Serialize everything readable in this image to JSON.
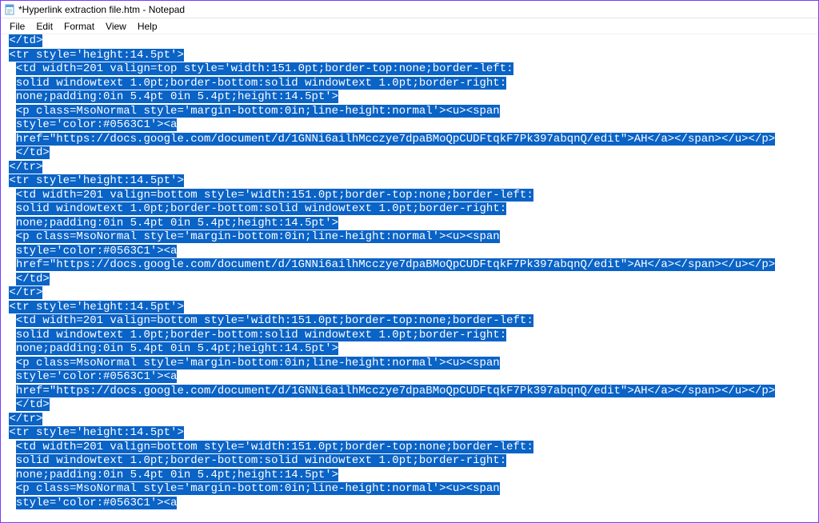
{
  "window": {
    "title": "*Hyperlink extraction file.htm - Notepad"
  },
  "menu": {
    "file": "File",
    "edit": "Edit",
    "format": "Format",
    "view": "View",
    "help": "Help"
  },
  "editor": {
    "lines": [
      " </td>",
      " <tr style='height:14.5pt'>",
      "  <td width=201 valign=top style='width:151.0pt;border-top:none;border-left:",
      "  solid windowtext 1.0pt;border-bottom:solid windowtext 1.0pt;border-right:",
      "  none;padding:0in 5.4pt 0in 5.4pt;height:14.5pt'>",
      "  <p class=MsoNormal style='margin-bottom:0in;line-height:normal'><u><span",
      "  style='color:#0563C1'><a",
      "  href=\"https://docs.google.com/document/d/1GNNi6ailhMcczye7dpaBMoQpCUDFtqkF7Pk397abqnQ/edit\">AH</a></span></u></p>",
      "  </td>",
      " </tr>",
      " <tr style='height:14.5pt'>",
      "  <td width=201 valign=bottom style='width:151.0pt;border-top:none;border-left:",
      "  solid windowtext 1.0pt;border-bottom:solid windowtext 1.0pt;border-right:",
      "  none;padding:0in 5.4pt 0in 5.4pt;height:14.5pt'>",
      "  <p class=MsoNormal style='margin-bottom:0in;line-height:normal'><u><span",
      "  style='color:#0563C1'><a",
      "  href=\"https://docs.google.com/document/d/1GNNi6ailhMcczye7dpaBMoQpCUDFtqkF7Pk397abqnQ/edit\">AH</a></span></u></p>",
      "  </td>",
      " </tr>",
      " <tr style='height:14.5pt'>",
      "  <td width=201 valign=bottom style='width:151.0pt;border-top:none;border-left:",
      "  solid windowtext 1.0pt;border-bottom:solid windowtext 1.0pt;border-right:",
      "  none;padding:0in 5.4pt 0in 5.4pt;height:14.5pt'>",
      "  <p class=MsoNormal style='margin-bottom:0in;line-height:normal'><u><span",
      "  style='color:#0563C1'><a",
      "  href=\"https://docs.google.com/document/d/1GNNi6ailhMcczye7dpaBMoQpCUDFtqkF7Pk397abqnQ/edit\">AH</a></span></u></p>",
      "  </td>",
      " </tr>",
      " <tr style='height:14.5pt'>",
      "  <td width=201 valign=bottom style='width:151.0pt;border-top:none;border-left:",
      "  solid windowtext 1.0pt;border-bottom:solid windowtext 1.0pt;border-right:",
      "  none;padding:0in 5.4pt 0in 5.4pt;height:14.5pt'>",
      "  <p class=MsoNormal style='margin-bottom:0in;line-height:normal'><u><span",
      "  style='color:#0563C1'><a"
    ],
    "selection_color": "#0a63c6"
  }
}
